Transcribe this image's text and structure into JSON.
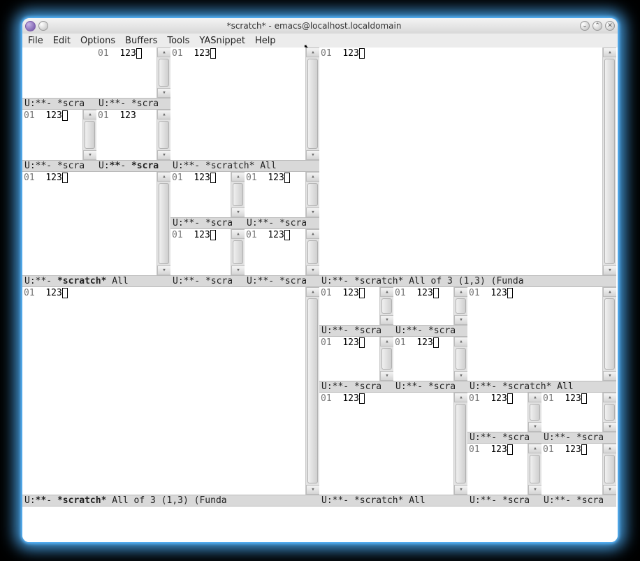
{
  "title": "*scratch* - emacs@localhost.localdomain",
  "titlebar_buttons": {
    "min": "⌄",
    "max": "⌃",
    "close": "✕"
  },
  "menu": [
    "File",
    "Edit",
    "Options",
    "Buffers",
    "Tools",
    "YASnippet",
    "Help"
  ],
  "sb": {
    "up": "▴",
    "dn": "▾"
  },
  "line_no": "01",
  "content": "123",
  "content_nocursor": "123",
  "ml": {
    "short": " U:**-  *scra",
    "scratch": " U:**-  *scratch*",
    "all": " U:**-  *scratch*   All",
    "long": " U:**-  *scratch*   All of 3   (1,3)       (Funda",
    "all_of3": " U:**-  *scratch*   All of 3   (1,3)       (Funda"
  }
}
